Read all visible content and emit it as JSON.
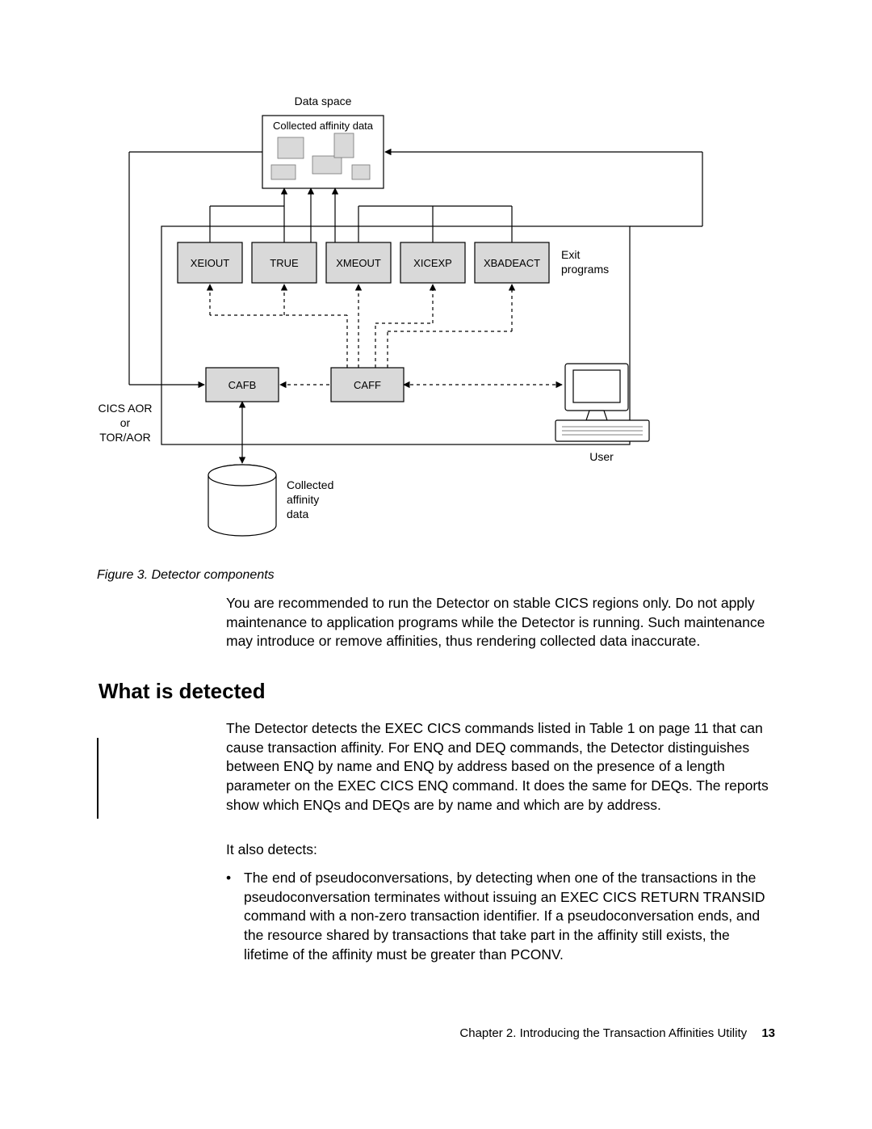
{
  "diagram": {
    "top_label": "Data space",
    "collected_box": "Collected affinity data",
    "exit_label_line1": "Exit",
    "exit_label_line2": "programs",
    "boxes_row": [
      "XEIOUT",
      "TRUE",
      "XMEOUT",
      "XICEXP",
      "XBADEACT"
    ],
    "cafb": "CAFB",
    "caff": "CAFF",
    "cics_line1": "CICS AOR",
    "cics_line2": "or",
    "cics_line3": "TOR/AOR",
    "user": "User",
    "cyl_line1": "Collected",
    "cyl_line2": "affinity",
    "cyl_line3": "data"
  },
  "caption": "Figure 3. Detector components",
  "para1": "You are recommended to run the Detector on stable CICS regions only. Do not apply maintenance to application programs while the Detector is running. Such maintenance may introduce or remove affinities, thus rendering collected data inaccurate.",
  "heading": "What is detected",
  "para2": "The Detector detects the EXEC CICS commands listed in Table 1 on page 11 that can cause transaction affinity. For ENQ and DEQ commands, the Detector distinguishes between ENQ by name and ENQ by address based on the presence of a length parameter on the EXEC CICS ENQ command. It does the same for DEQs. The reports show which ENQs and DEQs are by name and which are by address.",
  "para3": "It also detects:",
  "bullet1": "The end of pseudoconversations, by detecting when one of the transactions in the pseudoconversation terminates without issuing an EXEC CICS RETURN TRANSID command with a non-zero transaction identifier. If a pseudoconversation ends, and the resource shared by transactions that take part in the affinity still exists, the lifetime of the affinity must be greater than PCONV.",
  "footer_text": "Chapter 2. Introducing the Transaction Affinities Utility",
  "page_number": "13"
}
